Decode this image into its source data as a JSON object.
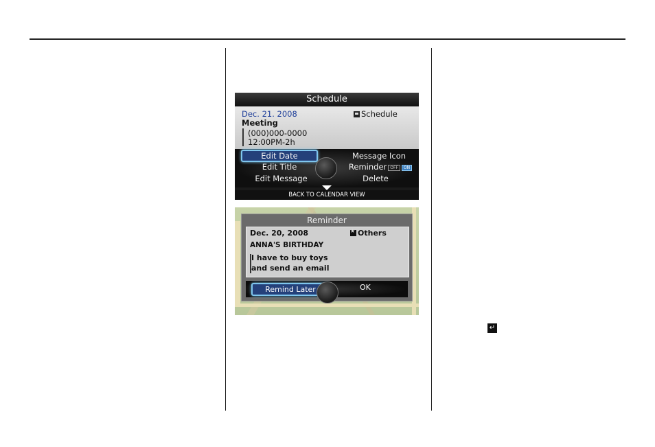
{
  "schedule_screen": {
    "title": "Schedule",
    "date": "Dec. 21. 2008",
    "category": "Schedule",
    "category_icon": "schedule-icon",
    "event_title": "Meeting",
    "line1": "(000)000-0000",
    "line2": "12:00PM-2h",
    "menu": {
      "edit_date": "Edit Date",
      "edit_title": "Edit Title",
      "edit_message": "Edit Message",
      "message_icon": "Message Icon",
      "reminder": "Reminder",
      "reminder_off": "OFF",
      "reminder_on": "ON",
      "delete": "Delete"
    },
    "bottom_label": "BACK TO CALENDAR VIEW"
  },
  "reminder_screen": {
    "title": "Reminder",
    "date": "Dec. 20, 2008",
    "category": "Others",
    "category_icon": "star-icon",
    "event_title": "ANNA'S BIRTHDAY",
    "line1": "I have to buy toys",
    "line2": "and send an email",
    "remind_later": "Remind Later",
    "ok": "OK"
  },
  "enter_icon_glyph": "↵",
  "colors": {
    "selected_bg": "#24407a",
    "selected_border": "#7fc6ee",
    "date_blue": "#1f3f9a"
  }
}
